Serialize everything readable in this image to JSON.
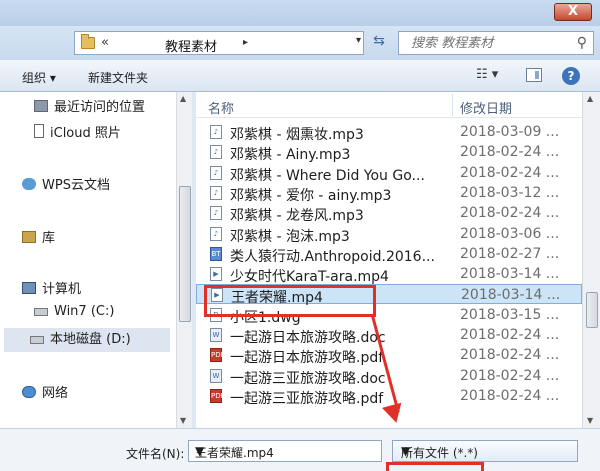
{
  "window": {
    "close_label": "X"
  },
  "address": {
    "separator": "«",
    "path": "教程素材",
    "arrow": "▸",
    "dropdown": "▾"
  },
  "search": {
    "placeholder": "搜索 教程素材"
  },
  "toolbar": {
    "organize": "组织 ▾",
    "new_folder": "新建文件夹",
    "view": "☷ ▾",
    "help": "?"
  },
  "nav": {
    "items": [
      {
        "label": "最近访问的位置",
        "icon": "recent-places-icon"
      },
      {
        "label": "iCloud 照片",
        "icon": "document-icon"
      },
      {
        "label": "WPS云文档",
        "icon": "cloud-icon"
      },
      {
        "label": "库",
        "icon": "library-icon"
      },
      {
        "label": "计算机",
        "icon": "computer-icon"
      },
      {
        "label": "Win7 (C:)",
        "icon": "drive-icon"
      },
      {
        "label": "本地磁盘 (D:)",
        "icon": "drive-icon"
      },
      {
        "label": "网络",
        "icon": "network-icon"
      }
    ],
    "selected": "本地磁盘 (D:)"
  },
  "list": {
    "columns": {
      "name": "名称",
      "date": "修改日期"
    },
    "rows": [
      {
        "name": "邓紫棋 - 烟熏妆.mp3",
        "date": "2018-03-09 ...",
        "type": "mp3"
      },
      {
        "name": "邓紫棋 - Ainy.mp3",
        "date": "2018-02-24 ...",
        "type": "mp3"
      },
      {
        "name": "邓紫棋 - Where Did You Go...",
        "date": "2018-02-24 ...",
        "type": "mp3"
      },
      {
        "name": "邓紫棋 - 爱你 - ainy.mp3",
        "date": "2018-03-12 ...",
        "type": "mp3"
      },
      {
        "name": "邓紫棋 - 龙卷风.mp3",
        "date": "2018-02-24 ...",
        "type": "mp3"
      },
      {
        "name": "邓紫棋 - 泡沫.mp3",
        "date": "2018-03-06 ...",
        "type": "mp3"
      },
      {
        "name": "类人猿行动.Anthropoid.2016...",
        "date": "2018-02-27 ...",
        "type": "bt"
      },
      {
        "name": "少女时代KaraT-ara.mp4",
        "date": "2018-03-14 ...",
        "type": "mp4"
      },
      {
        "name": "王者荣耀.mp4",
        "date": "2018-03-14 ...",
        "type": "mp4"
      },
      {
        "name": "小区1.dwg",
        "date": "2018-03-15 ...",
        "type": "dwg"
      },
      {
        "name": "一起游日本旅游攻略.doc",
        "date": "2018-02-24 ...",
        "type": "doc"
      },
      {
        "name": "一起游日本旅游攻略.pdf",
        "date": "2018-02-24 ...",
        "type": "pdf"
      },
      {
        "name": "一起游三亚旅游攻略.doc",
        "date": "2018-02-24 ...",
        "type": "doc"
      },
      {
        "name": "一起游三亚旅游攻略.pdf",
        "date": "2018-02-24 ...",
        "type": "pdf"
      }
    ],
    "selected_index": 8
  },
  "bottom": {
    "filename_label": "文件名(N):",
    "filename_value": "王者荣耀.mp4",
    "filetype_value": "所有文件 (*.*)"
  },
  "colors": {
    "annotation": "#e0302a",
    "selection": "#cce4f7"
  }
}
